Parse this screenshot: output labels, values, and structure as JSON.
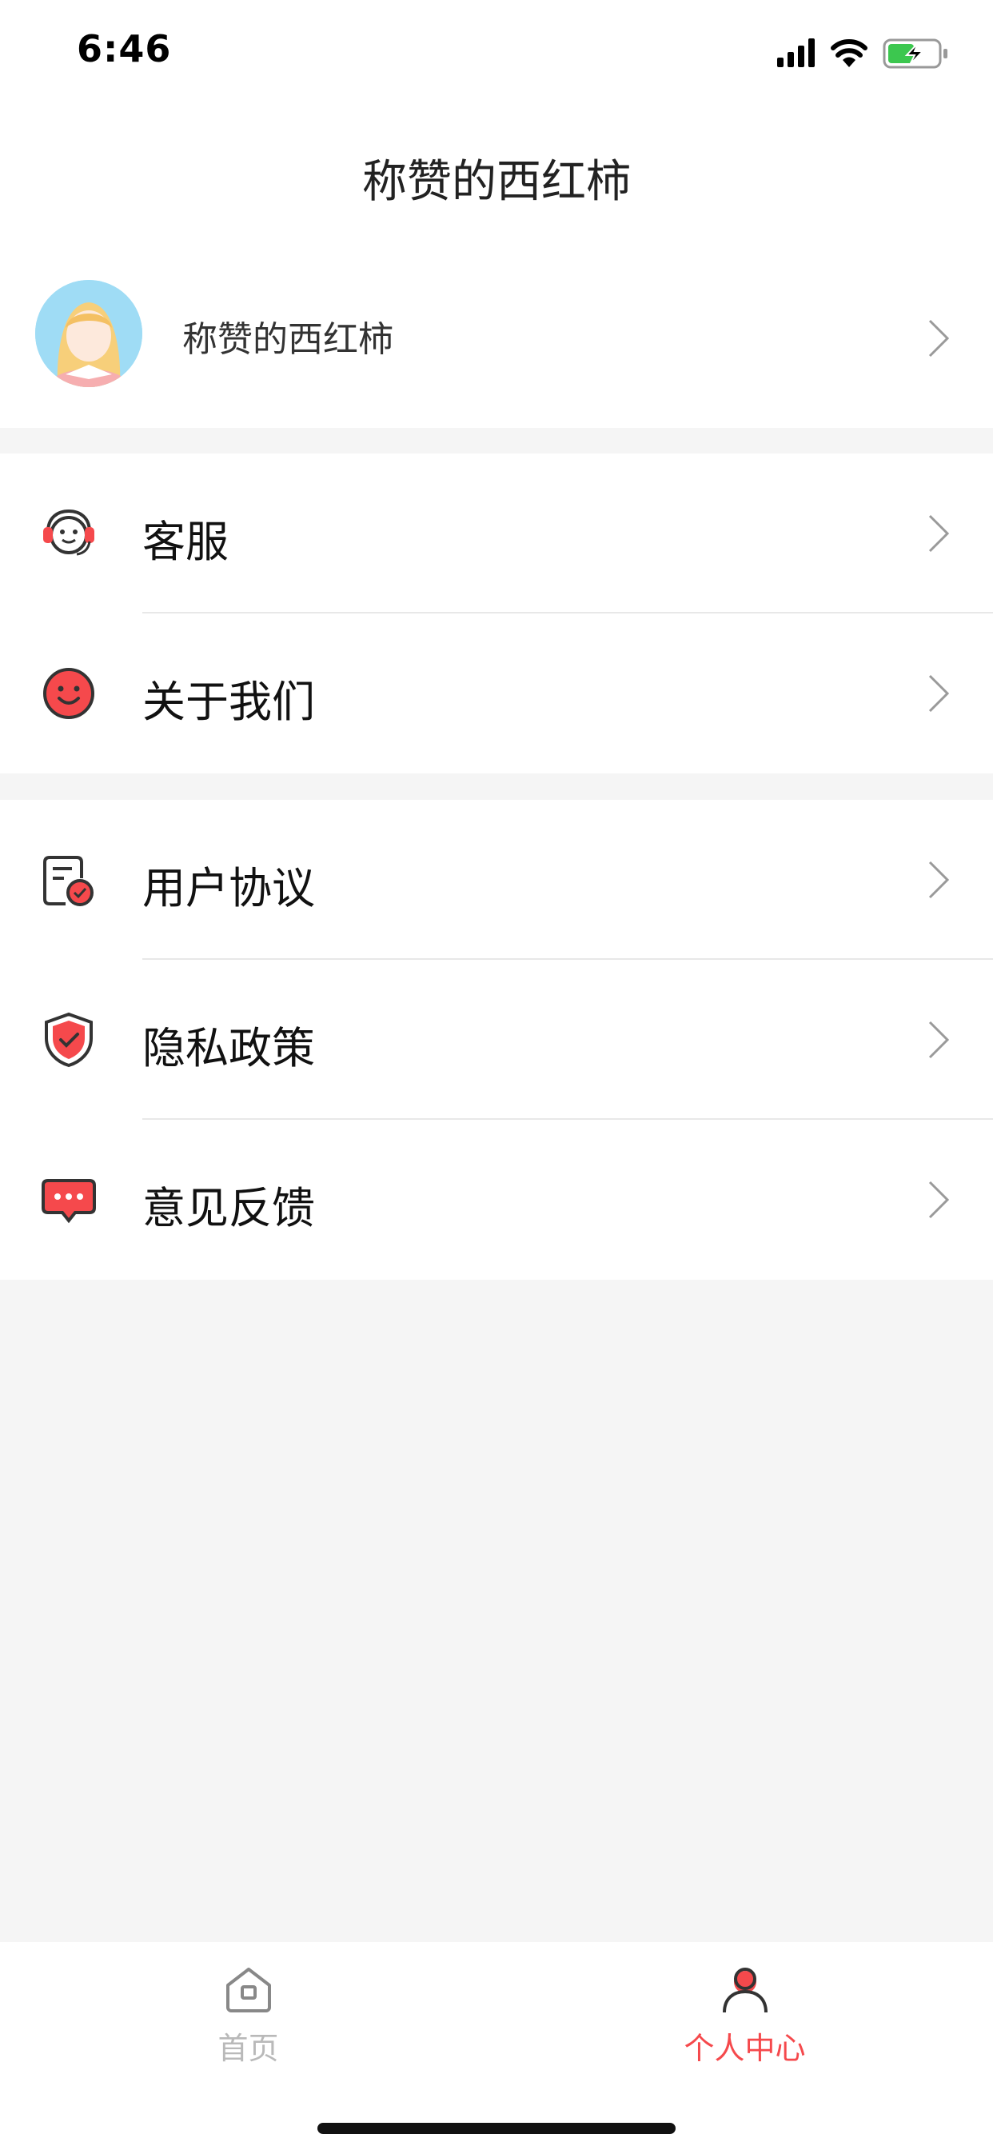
{
  "status_bar": {
    "time": "6:46"
  },
  "nav": {
    "title": "称赞的西红柿"
  },
  "profile": {
    "name": "称赞的西红柿"
  },
  "menu_group_1": [
    {
      "label": "客服",
      "icon": "headset-icon"
    },
    {
      "label": "关于我们",
      "icon": "smiley-icon"
    }
  ],
  "menu_group_2": [
    {
      "label": "用户协议",
      "icon": "agreement-document-icon"
    },
    {
      "label": "隐私政策",
      "icon": "shield-check-icon"
    },
    {
      "label": "意见反馈",
      "icon": "chat-bubble-icon"
    }
  ],
  "tabbar": {
    "items": [
      {
        "label": "首页",
        "icon": "home-icon",
        "active": false
      },
      {
        "label": "个人中心",
        "icon": "person-icon",
        "active": true
      }
    ]
  },
  "colors": {
    "accent": "#f5494c",
    "inactive": "#b9b9b9",
    "page_bg": "#f5f5f5"
  }
}
